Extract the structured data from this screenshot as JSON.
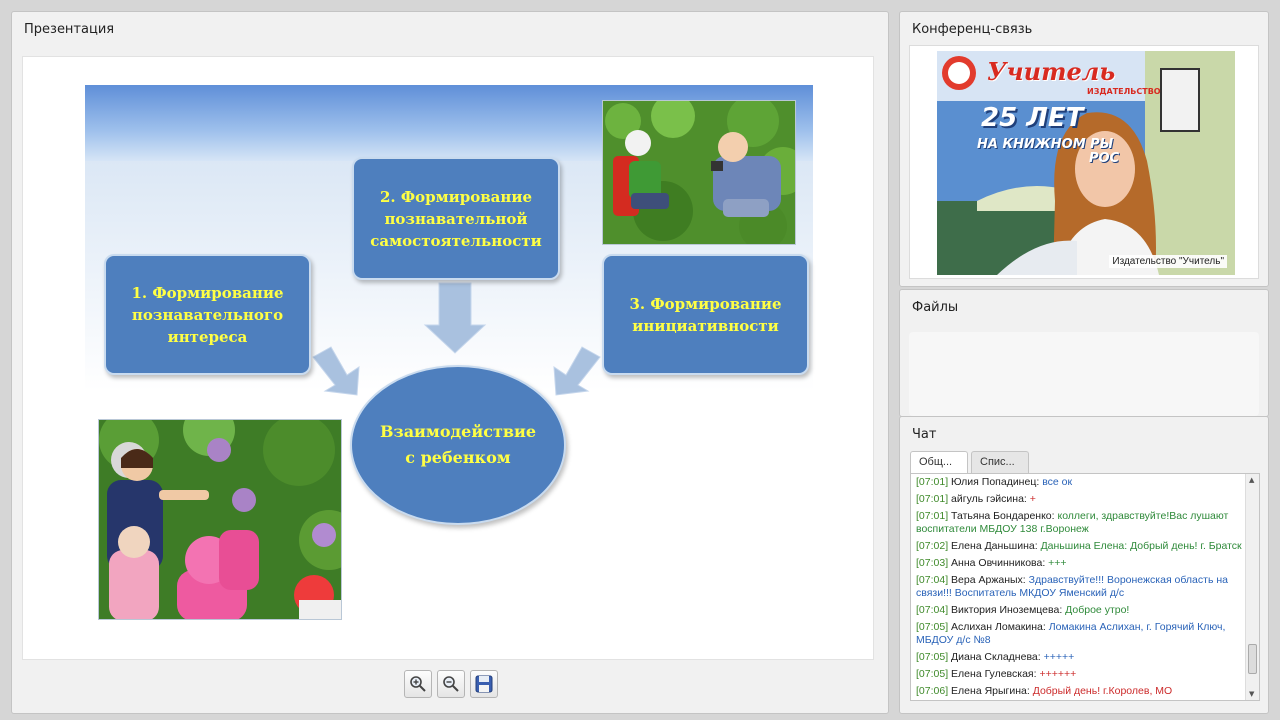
{
  "presentation": {
    "title": "Презентация",
    "slide": {
      "box1": "1.  Формирование\nпознавательного\nинтереса",
      "box2": "2.  Формирование\nпознавательной\nсамостоятельности",
      "box3": "3. Формирование\nинициативности",
      "center": "Взаимодействие\nс ребенком"
    },
    "toolbar": {
      "zoom_in_icon": "zoom-in-icon",
      "zoom_out_icon": "zoom-out-icon",
      "save_icon": "save-icon"
    }
  },
  "conference": {
    "title": "Конференц-связь",
    "caption": "Издательство \"Учитель\"",
    "banner_brand": "Учитель",
    "banner_sub": "ИЗДАТЕЛЬСТВО",
    "banner_years": "25 ЛЕТ",
    "banner_line": "НА КНИЖНОМ РЫ",
    "banner_line2": "РОС"
  },
  "files": {
    "title": "Файлы"
  },
  "chat": {
    "title": "Чат",
    "tabs": [
      "Общ...",
      "Спис..."
    ],
    "messages": [
      {
        "time": "[07:01]",
        "author": "Юлия Попадинец:",
        "text": "все ок",
        "color": "#2a63b8"
      },
      {
        "time": "[07:01]",
        "author": "айгуль гэйсина:",
        "text": "+",
        "color": "#cc2b2b"
      },
      {
        "time": "[07:01]",
        "author": "Татьяна Бондаренко:",
        "text": "коллеги, здравствуйте!Вас лушают воспитатели МБДОУ 138 г.Воронеж",
        "color": "#2f8a3a"
      },
      {
        "time": "[07:02]",
        "author": "Елена Даньшина:",
        "text": "Даньшина Елена: Добрый день! г. Братск",
        "color": "#2f8a3a"
      },
      {
        "time": "[07:03]",
        "author": "Анна Овчинникова:",
        "text": "+++",
        "color": "#2f8a3a"
      },
      {
        "time": "[07:04]",
        "author": "Вера Аржаных:",
        "text": "Здравствуйте!!! Воронежская область на связи!!! Воспитатель МКДОУ Яменский д/с",
        "color": "#2a63b8"
      },
      {
        "time": "[07:04]",
        "author": "Виктория Иноземцева:",
        "text": "Доброе утро!",
        "color": "#2f8a3a"
      },
      {
        "time": "[07:05]",
        "author": "Аслихан Ломакина:",
        "text": "Ломакина Аслихан, г. Горячий Ключ, МБДОУ д/с №8",
        "color": "#2a63b8"
      },
      {
        "time": "[07:05]",
        "author": "Диана Складнева:",
        "text": "+++++",
        "color": "#2a63b8"
      },
      {
        "time": "[07:05]",
        "author": "Елена Гулевская:",
        "text": "++++++",
        "color": "#cc2b2b"
      },
      {
        "time": "[07:06]",
        "author": "Елена Ярыгина:",
        "text": "Добрый день! г.Королев, МО",
        "color": "#cc2b2b"
      }
    ]
  }
}
